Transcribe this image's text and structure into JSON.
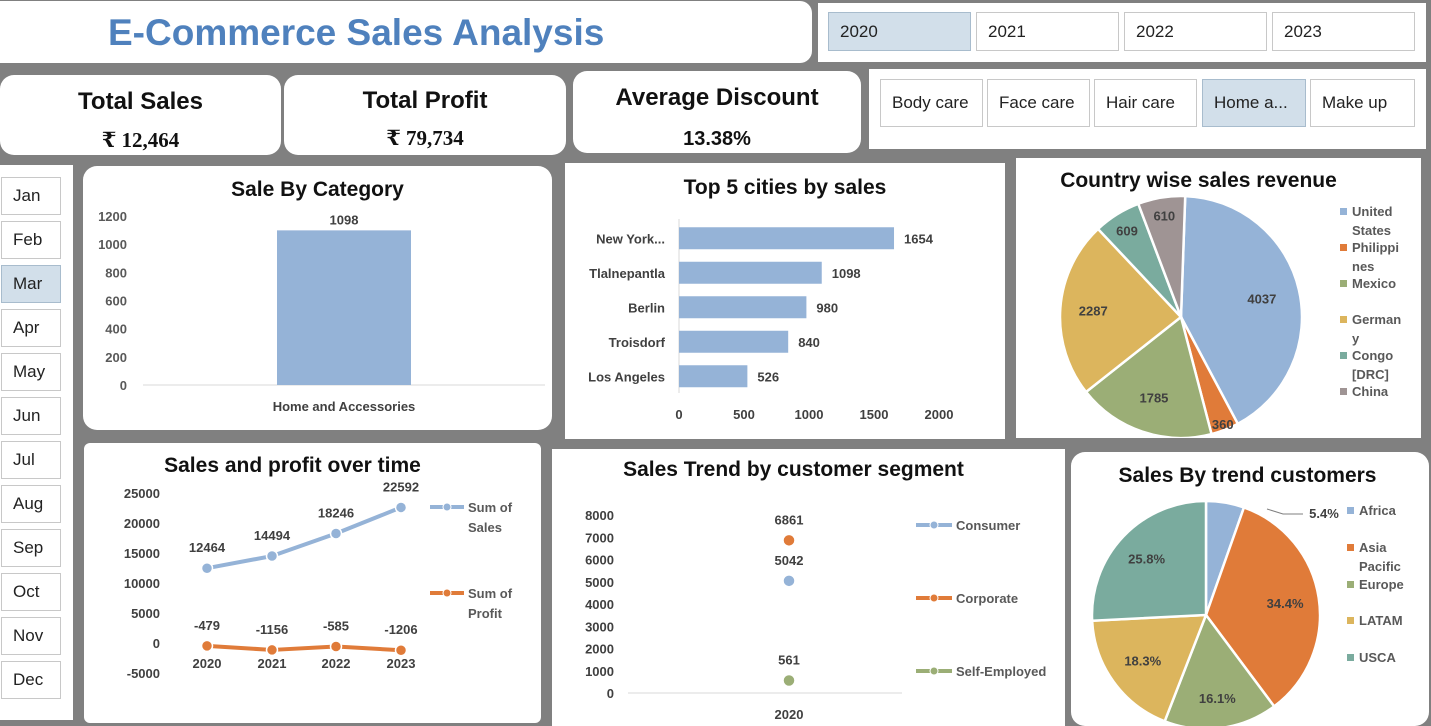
{
  "header": {
    "title": "E-Commerce Sales Analysis"
  },
  "year_slicer": {
    "items": [
      "2020",
      "2021",
      "2022",
      "2023"
    ],
    "selected": "2020"
  },
  "category_slicer": {
    "items": [
      "Body care",
      "Face care",
      "Hair care",
      "Home a...",
      "Make up"
    ],
    "selected": "Home a..."
  },
  "month_slicer": {
    "items": [
      "Jan",
      "Feb",
      "Mar",
      "Apr",
      "May",
      "Jun",
      "Jul",
      "Aug",
      "Sep",
      "Oct",
      "Nov",
      "Dec"
    ],
    "selected": "Mar"
  },
  "kpis": {
    "total_sales_label": "Total Sales",
    "total_sales_value": "₹ 12,464",
    "total_profit_label": "Total Profit",
    "total_profit_value": "₹  79,734",
    "avg_discount_label": "Average Discount",
    "avg_discount_value": "13.38%"
  },
  "colors": {
    "blue": "#95b3d7",
    "orange": "#e07b39",
    "olive": "#9bae76",
    "gold": "#dcb55d",
    "teal": "#7aab9e",
    "grey": "#9f9494",
    "selected": "#d2dfea"
  },
  "chart_data": [
    {
      "id": "sale_by_category",
      "type": "bar",
      "title": "Sale By Category",
      "categories": [
        "Home and Accessories"
      ],
      "values": [
        1098
      ],
      "ylim": [
        0,
        1200
      ],
      "yticks": [
        "0",
        "200",
        "400",
        "600",
        "800",
        "1000",
        "1200"
      ],
      "data_labels": [
        "1098"
      ]
    },
    {
      "id": "top_cities",
      "type": "bar",
      "orientation": "horizontal",
      "title": "Top 5 cities by sales",
      "categories": [
        "New York...",
        "Tlalnepantla",
        "Berlin",
        "Troisdorf",
        "Los Angeles"
      ],
      "values": [
        1654,
        1098,
        980,
        840,
        526
      ],
      "data_labels": [
        "1654",
        "1098",
        "980",
        "840",
        "526"
      ],
      "xlim": [
        0,
        2000
      ],
      "xticks": [
        "0",
        "500",
        "1000",
        "1500",
        "2000"
      ]
    },
    {
      "id": "country_sales",
      "type": "pie",
      "title": "Country wise sales revenue",
      "labels": [
        "United States",
        "Philippines",
        "Mexico",
        "Germany",
        "Congo [DRC]",
        "China"
      ],
      "legend_lines": [
        [
          "United",
          "States"
        ],
        [
          "Philippi",
          "nes"
        ],
        [
          "Mexico"
        ],
        [
          "German",
          "y"
        ],
        [
          "Congo",
          "[DRC]"
        ],
        [
          "China"
        ]
      ],
      "values": [
        4037,
        360,
        1785,
        2287,
        609,
        610
      ],
      "data_labels": [
        "4037",
        "360",
        "1785",
        "2287",
        "609",
        "610"
      ],
      "legend": "right"
    },
    {
      "id": "sales_profit_time",
      "type": "line",
      "title": "Sales and profit over time",
      "x": [
        "2020",
        "2021",
        "2022",
        "2023"
      ],
      "series": [
        {
          "name": "Sum of Sales",
          "legend_lines": [
            "Sum of",
            "Sales"
          ],
          "values": [
            12464,
            14494,
            18246,
            22592
          ],
          "data_labels": [
            "12464",
            "14494",
            "18246",
            "22592"
          ]
        },
        {
          "name": "Sum of Profit",
          "legend_lines": [
            "Sum of",
            "Profit"
          ],
          "values": [
            -479,
            -1156,
            -585,
            -1206
          ],
          "data_labels": [
            "-479",
            "-1156",
            "-585",
            "-1206"
          ]
        }
      ],
      "ylim": [
        -5000,
        25000
      ],
      "yticks": [
        "-5000",
        "0",
        "5000",
        "10000",
        "15000",
        "20000",
        "25000"
      ],
      "legend": "right"
    },
    {
      "id": "segment_trend",
      "type": "scatter",
      "title": "Sales Trend by customer segment",
      "x": [
        "2020"
      ],
      "series": [
        {
          "name": "Consumer",
          "values": [
            5042
          ],
          "data_labels": [
            "5042"
          ]
        },
        {
          "name": "Corporate",
          "values": [
            6861
          ],
          "data_labels": [
            "6861"
          ]
        },
        {
          "name": "Self-Employed",
          "values": [
            561
          ],
          "data_labels": [
            "561"
          ]
        }
      ],
      "ylim": [
        0,
        8000
      ],
      "yticks": [
        "0",
        "1000",
        "2000",
        "3000",
        "4000",
        "5000",
        "6000",
        "7000",
        "8000"
      ],
      "legend": "right"
    },
    {
      "id": "trend_customers",
      "type": "pie",
      "title": "Sales By trend customers",
      "labels": [
        "Africa",
        "Asia Pacific",
        "Europe",
        "LATAM",
        "USCA"
      ],
      "legend_lines": [
        [
          "Africa"
        ],
        [
          "Asia",
          "Pacific"
        ],
        [
          "Europe"
        ],
        [
          "LATAM"
        ],
        [
          "USCA"
        ]
      ],
      "values": [
        5.4,
        34.4,
        16.1,
        18.3,
        25.8
      ],
      "data_labels": [
        "5.4%",
        "34.4%",
        "16.1%",
        "18.3%",
        "25.8%"
      ],
      "legend": "right"
    }
  ]
}
